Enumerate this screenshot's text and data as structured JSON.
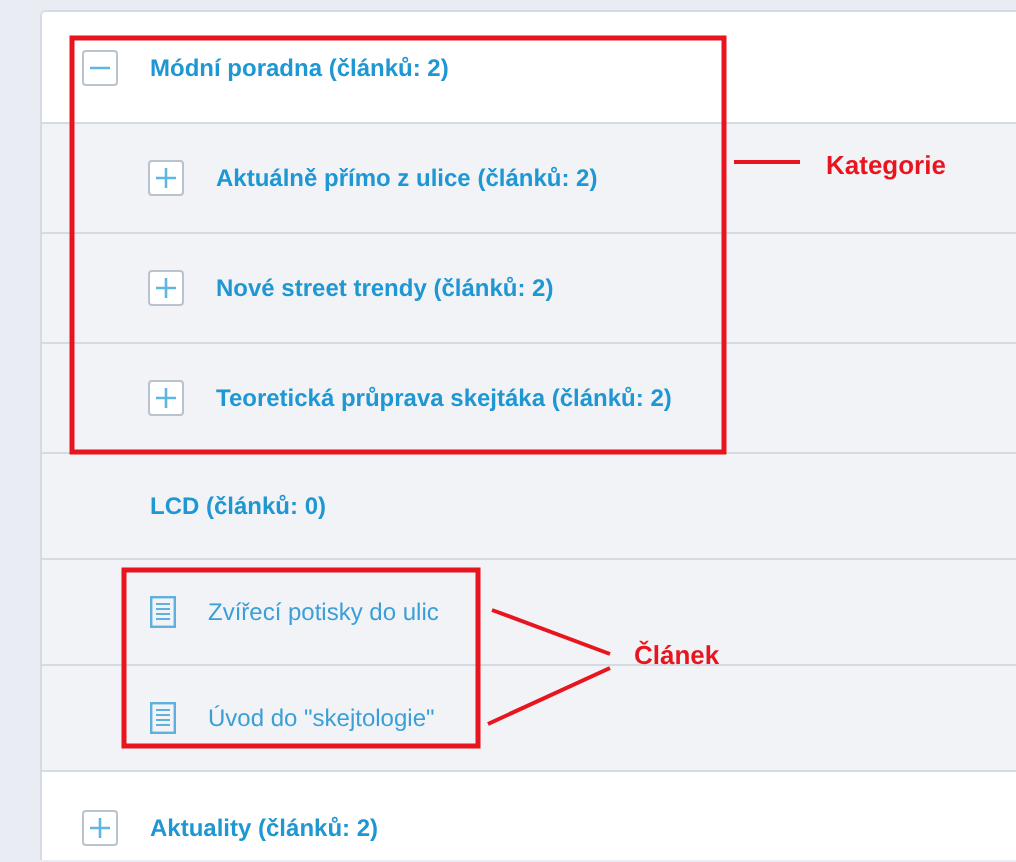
{
  "tree": [
    {
      "label": "Módní poradna (článků: 2)",
      "kind": "category",
      "expanded": true,
      "children": [
        {
          "label": "Aktuálně přímo z ulice (článků: 2)",
          "kind": "category",
          "expanded": false
        },
        {
          "label": "Nové street trendy (článků: 2)",
          "kind": "category",
          "expanded": false
        },
        {
          "label": "Teoretická průprava skejtáka (článků: 2)",
          "kind": "category",
          "expanded": false
        },
        {
          "label": "LCD (článků: 0)",
          "kind": "empty-category"
        },
        {
          "label": "Zvířecí potisky do ulic",
          "kind": "article"
        },
        {
          "label": "Úvod do \"skejtologie\"",
          "kind": "article"
        }
      ]
    },
    {
      "label": "Aktuality (článků: 2)",
      "kind": "category",
      "expanded": false
    }
  ],
  "annotations": [
    {
      "label": "Kategorie"
    },
    {
      "label": "Článek"
    }
  ]
}
